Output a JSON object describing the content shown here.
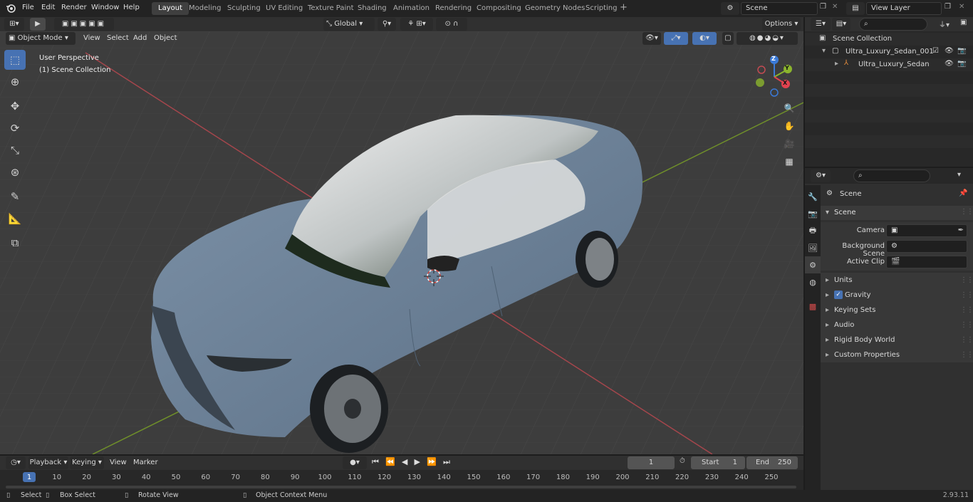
{
  "topbar": {
    "menus": [
      "File",
      "Edit",
      "Render",
      "Window",
      "Help"
    ],
    "workspaces": [
      "Layout",
      "Modeling",
      "Sculpting",
      "UV Editing",
      "Texture Paint",
      "Shading",
      "Animation",
      "Rendering",
      "Compositing",
      "Geometry Nodes",
      "Scripting"
    ],
    "active_workspace": "Layout",
    "add_tab": "+",
    "scene_name": "Scene",
    "view_layer": "View Layer"
  },
  "viewport_header": {
    "transform_orientation": "Global",
    "options_label": "Options",
    "mode": "Object Mode",
    "menus": [
      "View",
      "Select",
      "Add",
      "Object"
    ]
  },
  "viewport": {
    "overlay_line1": "User Perspective",
    "overlay_line2": "(1) Scene Collection",
    "gizmo_axes": {
      "z": "Z",
      "y": "Y",
      "x": "X"
    }
  },
  "outliner": {
    "search_placeholder": "",
    "root": "Scene Collection",
    "collection": "Ultra_Luxury_Sedan_001",
    "object": "Ultra_Luxury_Sedan"
  },
  "properties": {
    "header_title": "Scene",
    "panel_title": "Scene",
    "fields": [
      {
        "label": "Camera",
        "value": ""
      },
      {
        "label": "Background Scene",
        "value": ""
      },
      {
        "label": "Active Clip",
        "value": ""
      }
    ],
    "sections": [
      "Units",
      "Gravity",
      "Keying Sets",
      "Audio",
      "Rigid Body World",
      "Custom Properties"
    ],
    "gravity_checked": true
  },
  "timeline": {
    "menus": [
      "Playback",
      "Keying",
      "View",
      "Marker"
    ],
    "current_frame": "1",
    "start_label": "Start",
    "start_value": "1",
    "end_label": "End",
    "end_value": "250",
    "ticks": [
      "1",
      "10",
      "20",
      "30",
      "40",
      "50",
      "60",
      "70",
      "80",
      "90",
      "100",
      "110",
      "120",
      "130",
      "140",
      "150",
      "160",
      "170",
      "180",
      "190",
      "200",
      "210",
      "220",
      "230",
      "240",
      "250"
    ]
  },
  "statusbar": {
    "items": [
      "Select",
      "Box Select",
      "Rotate View",
      "Object Context Menu"
    ],
    "version": "2.93.11"
  },
  "colors": {
    "accent": "#4772b3",
    "car_body": "#6a7f96",
    "viewport_bg": "#3d3d3d",
    "axis_x": "#c34b52",
    "axis_y": "#7aa12f"
  }
}
